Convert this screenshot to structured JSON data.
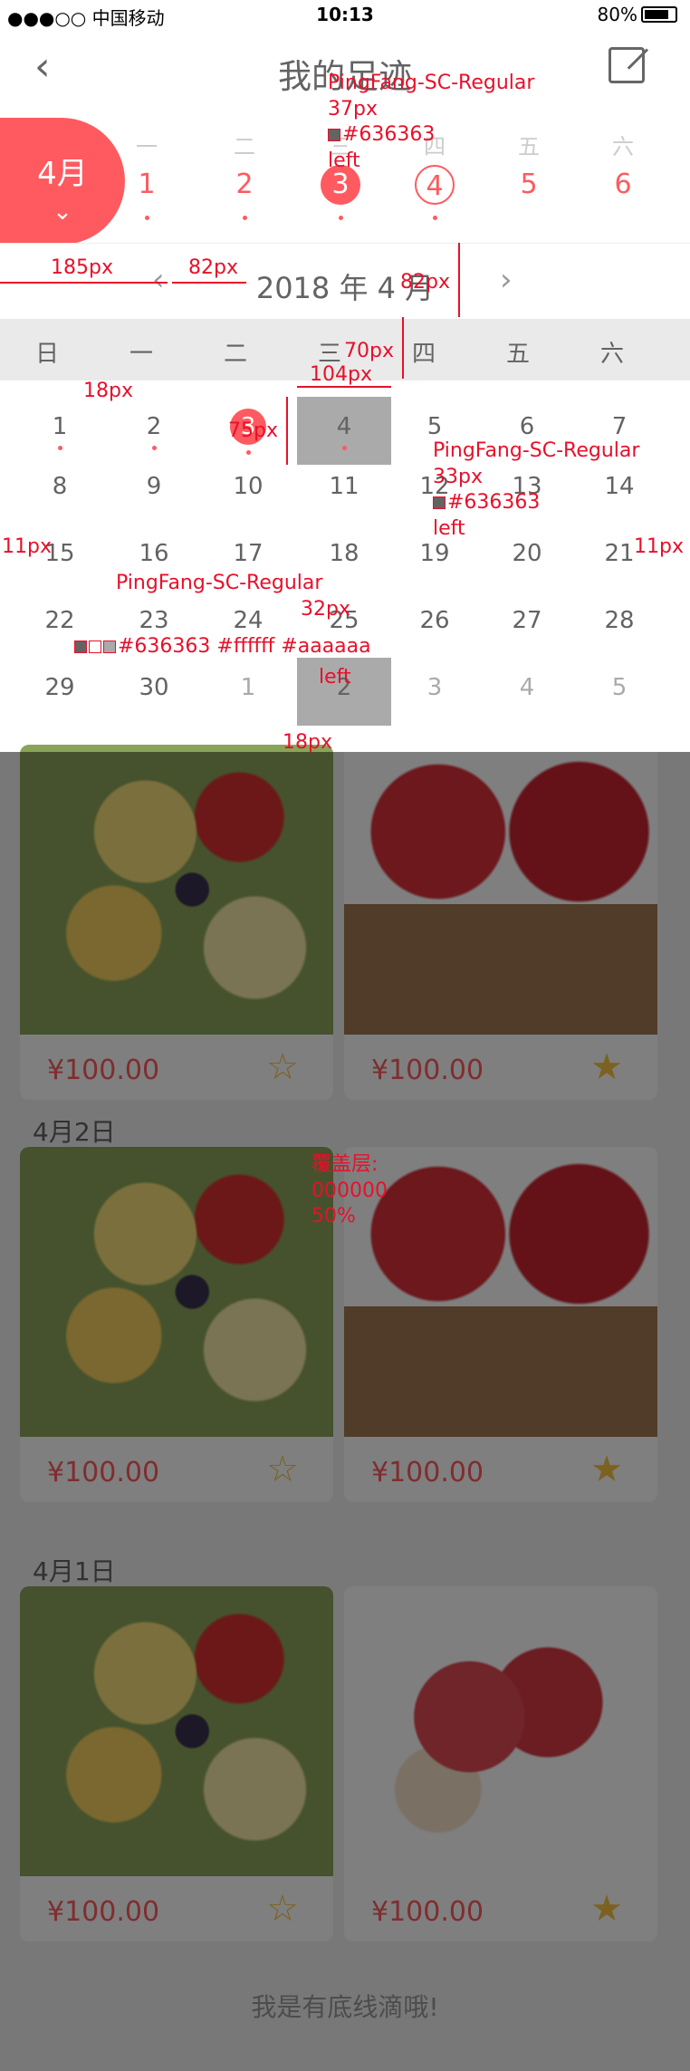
{
  "status_bar": {
    "carrier": "●●●○○ 中国移动",
    "time": "10:13",
    "battery": "80%"
  },
  "nav": {
    "title": "我的足迹"
  },
  "week_strip": {
    "month_button": "4月",
    "days": [
      {
        "weekday": "一",
        "num": "1",
        "state": "normal"
      },
      {
        "weekday": "二",
        "num": "2",
        "state": "normal"
      },
      {
        "weekday": "三",
        "num": "3",
        "state": "selected"
      },
      {
        "weekday": "四",
        "num": "4",
        "state": "ring"
      },
      {
        "weekday": "五",
        "num": "5",
        "state": "plain"
      },
      {
        "weekday": "六",
        "num": "6",
        "state": "plain"
      }
    ]
  },
  "month": {
    "title": "2018 年 4 月",
    "prev_icon": "chevron-left-icon",
    "next_icon": "chevron-right-icon",
    "weekdays": [
      "日",
      "一",
      "二",
      "三",
      "四",
      "五",
      "六"
    ],
    "weeks": [
      [
        "1",
        "2",
        "3",
        "4",
        "5",
        "6",
        "7"
      ],
      [
        "8",
        "9",
        "10",
        "11",
        "12",
        "13",
        "14"
      ],
      [
        "15",
        "16",
        "17",
        "18",
        "19",
        "20",
        "21"
      ],
      [
        "22",
        "23",
        "24",
        "25",
        "26",
        "27",
        "28"
      ],
      [
        "29",
        "30",
        "1",
        "2",
        "3",
        "4",
        "5"
      ]
    ]
  },
  "sections": [
    {
      "label": "",
      "cards": [
        {
          "price": "¥100.00",
          "fav": false,
          "img": "fruit"
        },
        {
          "price": "¥100.00",
          "fav": true,
          "img": "apple"
        }
      ]
    },
    {
      "label": "4月2日",
      "cards": [
        {
          "price": "¥100.00",
          "fav": false,
          "img": "fruit"
        },
        {
          "price": "¥100.00",
          "fav": true,
          "img": "apple"
        }
      ]
    },
    {
      "label": "4月1日",
      "cards": [
        {
          "price": "¥100.00",
          "fav": false,
          "img": "fruit"
        },
        {
          "price": "¥100.00",
          "fav": true,
          "img": "apple2"
        }
      ]
    }
  ],
  "footer": "我是有底线滴哦!",
  "annotations": {
    "title_font": "PingFang-SC-Regular",
    "title_size": "37px",
    "title_color": "#636363",
    "title_align": "left",
    "dim_185": "185px",
    "dim_82a": "82px",
    "dim_82b": "82px",
    "dim_70": "70px",
    "dim_104": "104px",
    "dim_18a": "18px",
    "dim_75": "75px",
    "weekday_font": "PingFang-SC-Regular",
    "weekday_size": "33px",
    "weekday_color": "#636363",
    "weekday_align": "left",
    "dim_11a": "11px",
    "dim_11b": "11px",
    "day_font": "PingFang-SC-Regular",
    "day_size": "32px",
    "day_colors": "#636363 #ffffff #aaaaaa",
    "day_align": "left",
    "dim_18b": "18px",
    "overlay_label": "覆盖层:",
    "overlay_color": "000000",
    "overlay_opacity": "50%"
  },
  "colors": {
    "accent": "#ff5a5f",
    "text": "#636363",
    "muted": "#aaaaaa",
    "today_bg": "#aaaaaa"
  }
}
